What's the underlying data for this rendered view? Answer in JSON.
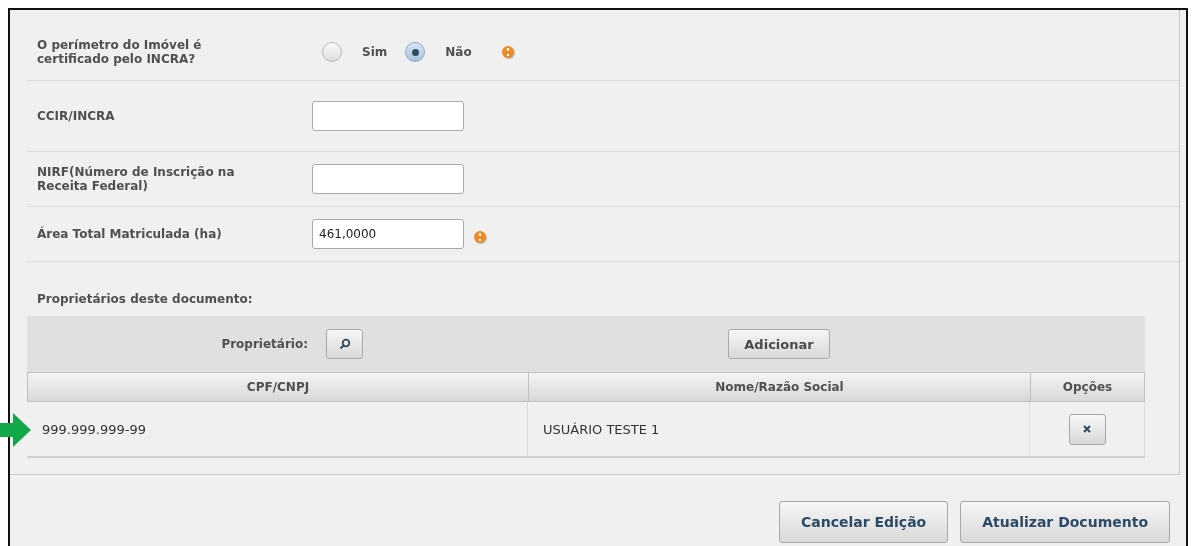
{
  "question": {
    "label": "O perímetro do Imóvel é certificado pelo INCRA?",
    "warning": true,
    "options": [
      {
        "label": "Sim",
        "selected": false
      },
      {
        "label": "Não",
        "selected": true
      }
    ]
  },
  "fields": [
    {
      "label": "CCIR/INCRA",
      "warning": false
    },
    {
      "label": "NIRF(Número de Inscrição na Receita Federal)",
      "warning": false
    },
    {
      "label": "Área Total Matriculada (ha)",
      "value": "461,0000",
      "warning": true
    }
  ],
  "owners": {
    "title": "Proprietários deste documento:",
    "owner_label": "Proprietário:",
    "add_button": "Adicionar",
    "columns": [
      "CPF/CNPJ",
      "Nome/Razão Social",
      "Opções"
    ],
    "rows": [
      {
        "cpf": "999.999.999-99",
        "name": "USUÁRIO TESTE 1",
        "pointed": true
      }
    ]
  },
  "buttons": [
    "Cancelar Edição",
    "Atualizar Documento"
  ]
}
